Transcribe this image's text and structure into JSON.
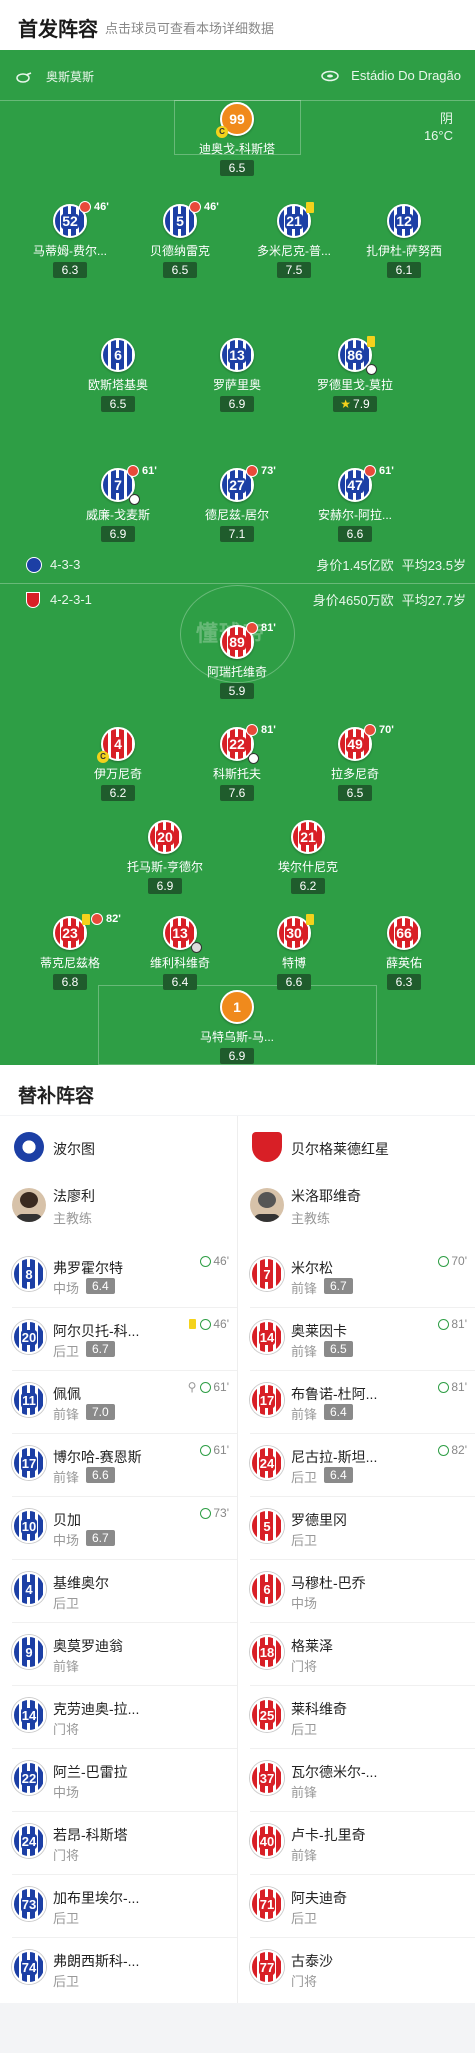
{
  "header": {
    "title": "首发阵容",
    "subtitle": "点击球员可查看本场详细数据"
  },
  "pitch": {
    "home_team": "奥斯莫斯",
    "venue": "Estádio Do Dragão",
    "weather": "阴",
    "temp": "16°C",
    "home_formation": "4-3-3",
    "home_value": "身价1.45亿欧",
    "home_age": "平均23.5岁",
    "away_formation": "4-2-3-1",
    "away_value": "身价4650万欧",
    "away_age": "平均27.7岁",
    "watermark": "懂球帝"
  },
  "home_lineup": [
    {
      "num": "99",
      "name": "迪奥戈-科斯塔",
      "rating": "6.5"
    },
    {
      "num": "52",
      "name": "马蒂姆-费尔...",
      "rating": "6.3",
      "sub": "46'"
    },
    {
      "num": "5",
      "name": "贝德纳雷克",
      "rating": "6.5",
      "sub": "46'"
    },
    {
      "num": "21",
      "name": "多米尼克-普...",
      "rating": "7.5"
    },
    {
      "num": "12",
      "name": "扎伊杜-萨努西",
      "rating": "6.1"
    },
    {
      "num": "6",
      "name": "欧斯塔基奥",
      "rating": "6.5"
    },
    {
      "num": "13",
      "name": "罗萨里奥",
      "rating": "6.9"
    },
    {
      "num": "86",
      "name": "罗德里戈-莫拉",
      "rating": "7.9"
    },
    {
      "num": "7",
      "name": "威廉-戈麦斯",
      "rating": "6.9",
      "sub": "61'"
    },
    {
      "num": "27",
      "name": "德尼兹-居尔",
      "rating": "7.1",
      "sub": "73'"
    },
    {
      "num": "47",
      "name": "安赫尔-阿拉...",
      "rating": "6.6",
      "sub": "61'"
    }
  ],
  "away_lineup": [
    {
      "num": "89",
      "name": "阿瑞托维奇",
      "rating": "5.9",
      "sub": "81'"
    },
    {
      "num": "4",
      "name": "伊万尼奇",
      "rating": "6.2"
    },
    {
      "num": "22",
      "name": "科斯托夫",
      "rating": "7.6",
      "sub": "81'"
    },
    {
      "num": "49",
      "name": "拉多尼奇",
      "rating": "6.5",
      "sub": "70'"
    },
    {
      "num": "20",
      "name": "托马斯-亨德尔",
      "rating": "6.9"
    },
    {
      "num": "21",
      "name": "埃尔什尼克",
      "rating": "6.2"
    },
    {
      "num": "23",
      "name": "蒂克尼兹格",
      "rating": "6.8",
      "sub": "82'"
    },
    {
      "num": "13",
      "name": "维利科维奇",
      "rating": "6.4"
    },
    {
      "num": "30",
      "name": "特博",
      "rating": "6.6"
    },
    {
      "num": "66",
      "name": "薛英佑",
      "rating": "6.3"
    },
    {
      "num": "1",
      "name": "马特乌斯-马...",
      "rating": "6.9"
    }
  ],
  "subs": {
    "title": "替补阵容",
    "home": {
      "team": "波尔图",
      "coach": "法廖利",
      "coach_role": "主教练"
    },
    "away": {
      "team": "贝尔格莱德红星",
      "coach": "米洛耶维奇",
      "coach_role": "主教练"
    },
    "home_list": [
      {
        "num": "8",
        "name": "弗罗霍尔特",
        "pos": "中场",
        "rating": "6.4",
        "time": "46'"
      },
      {
        "num": "20",
        "name": "阿尔贝托-科...",
        "pos": "后卫",
        "rating": "6.7",
        "time": "46'"
      },
      {
        "num": "11",
        "name": "佩佩",
        "pos": "前锋",
        "rating": "7.0",
        "time": "61'"
      },
      {
        "num": "17",
        "name": "博尔哈-赛恩斯",
        "pos": "前锋",
        "rating": "6.6",
        "time": "61'"
      },
      {
        "num": "10",
        "name": "贝加",
        "pos": "中场",
        "rating": "6.7",
        "time": "73'"
      },
      {
        "num": "4",
        "name": "基维奥尔",
        "pos": "后卫"
      },
      {
        "num": "9",
        "name": "奥莫罗迪翁",
        "pos": "前锋"
      },
      {
        "num": "14",
        "name": "克劳迪奥-拉...",
        "pos": "门将"
      },
      {
        "num": "22",
        "name": "阿兰-巴雷拉",
        "pos": "中场"
      },
      {
        "num": "24",
        "name": "若昂-科斯塔",
        "pos": "门将"
      },
      {
        "num": "73",
        "name": "加布里埃尔-...",
        "pos": "后卫"
      },
      {
        "num": "74",
        "name": "弗朗西斯科-...",
        "pos": "后卫"
      }
    ],
    "away_list": [
      {
        "num": "7",
        "name": "米尔松",
        "pos": "前锋",
        "rating": "6.7",
        "time": "70'"
      },
      {
        "num": "14",
        "name": "奥莱因卡",
        "pos": "前锋",
        "rating": "6.5",
        "time": "81'"
      },
      {
        "num": "17",
        "name": "布鲁诺-杜阿...",
        "pos": "前锋",
        "rating": "6.4",
        "time": "81'"
      },
      {
        "num": "24",
        "name": "尼古拉-斯坦...",
        "pos": "后卫",
        "rating": "6.4",
        "time": "82'"
      },
      {
        "num": "5",
        "name": "罗德里冈",
        "pos": "后卫"
      },
      {
        "num": "6",
        "name": "马穆杜-巴乔",
        "pos": "中场"
      },
      {
        "num": "18",
        "name": "格莱泽",
        "pos": "门将"
      },
      {
        "num": "25",
        "name": "莱科维奇",
        "pos": "后卫"
      },
      {
        "num": "37",
        "name": "瓦尔德米尔-...",
        "pos": "前锋"
      },
      {
        "num": "40",
        "name": "卢卡-扎里奇",
        "pos": "前锋"
      },
      {
        "num": "71",
        "name": "阿夫迪奇",
        "pos": "后卫"
      },
      {
        "num": "77",
        "name": "古泰沙",
        "pos": "门将"
      }
    ]
  },
  "colors": {
    "pitch": "#2e9e45",
    "home": "#1c3fa5",
    "away": "#d81f26",
    "gk": "#f08a1c"
  }
}
